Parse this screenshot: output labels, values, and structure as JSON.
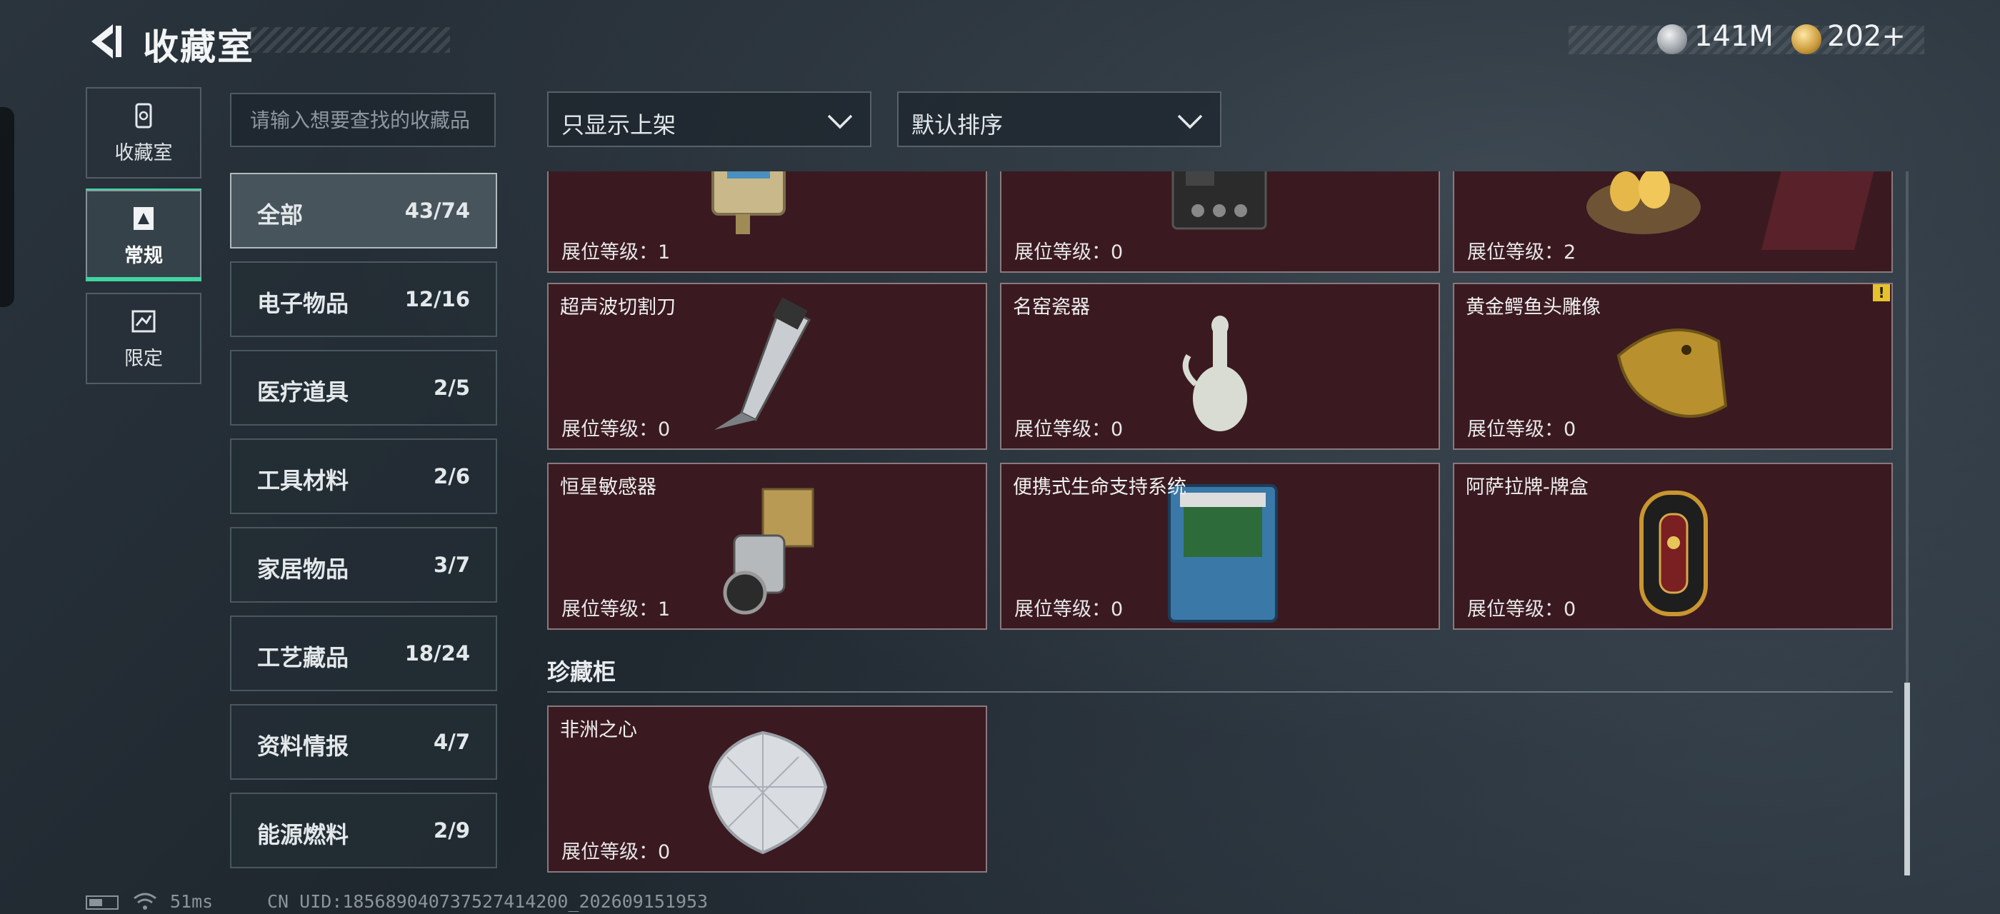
{
  "header": {
    "title": "收藏室",
    "currency": [
      {
        "icon": "silver-coin-icon",
        "value": "141M"
      },
      {
        "icon": "gold-coin-icon",
        "value": "202+"
      }
    ]
  },
  "nav": [
    {
      "label": "收藏室",
      "icon": "collection-room-icon",
      "active": false
    },
    {
      "label": "常规",
      "icon": "regular-icon",
      "active": true
    },
    {
      "label": "限定",
      "icon": "limited-icon",
      "active": false
    }
  ],
  "search": {
    "placeholder": "请输入想要查找的收藏品"
  },
  "filters": {
    "display": "只显示上架",
    "sort": "默认排序"
  },
  "categories": [
    {
      "name": "全部",
      "count": "43/74",
      "active": true
    },
    {
      "name": "电子物品",
      "count": "12/16",
      "active": false
    },
    {
      "name": "医疗道具",
      "count": "2/5",
      "active": false
    },
    {
      "name": "工具材料",
      "count": "2/6",
      "active": false
    },
    {
      "name": "家居物品",
      "count": "3/7",
      "active": false
    },
    {
      "name": "工艺藏品",
      "count": "18/24",
      "active": false
    },
    {
      "name": "资料情报",
      "count": "4/7",
      "active": false
    },
    {
      "name": "能源燃料",
      "count": "2/9",
      "active": false
    }
  ],
  "level_label": "展位等级：",
  "items": [
    {
      "name": "",
      "level": "1",
      "art": "electronic-device"
    },
    {
      "name": "",
      "level": "0",
      "art": "tape-recorder"
    },
    {
      "name": "",
      "level": "2",
      "art": "golden-eggs-nest"
    },
    {
      "name": "超声波切割刀",
      "level": "0",
      "art": "ultrasonic-knife"
    },
    {
      "name": "名窑瓷器",
      "level": "0",
      "art": "porcelain-vase"
    },
    {
      "name": "黄金鳄鱼头雕像",
      "level": "0",
      "art": "golden-crocodile",
      "warning": "!"
    },
    {
      "name": "恒星敏感器",
      "level": "1",
      "art": "star-sensor"
    },
    {
      "name": "便携式生命支持系统",
      "level": "0",
      "art": "life-support"
    },
    {
      "name": "阿萨拉牌-牌盒",
      "level": "0",
      "art": "card-box"
    }
  ],
  "showcase": {
    "title": "珍藏柜",
    "items": [
      {
        "name": "非洲之心",
        "level": "0",
        "art": "diamond"
      }
    ]
  },
  "status": {
    "ping": "51ms",
    "uid": "CN UID:1856890407375274142​00_202609151953"
  },
  "colors": {
    "accent": "#3fd4a0",
    "card_bg": "#3a1a20",
    "warning": "#e8c22c"
  }
}
